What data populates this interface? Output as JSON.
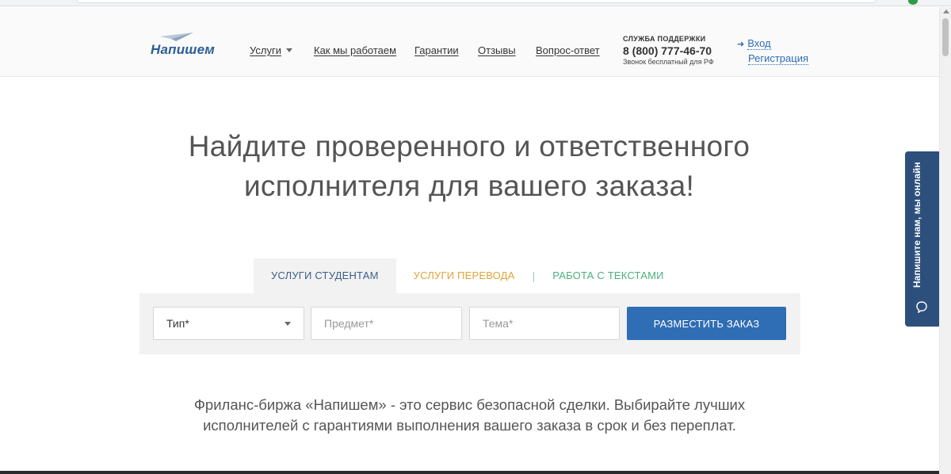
{
  "header": {
    "logo_text": "Напишем",
    "nav": {
      "services": "Услуги",
      "how": "Как мы работаем",
      "guarantees": "Гарантии",
      "reviews": "Отзывы",
      "faq": "Вопрос-ответ"
    },
    "support": {
      "title": "СЛУЖБА ПОДДЕРЖКИ",
      "phone": "8 (800) 777-46-70",
      "note": "Звонок бесплатный для РФ"
    },
    "auth": {
      "login": "Вход",
      "register": "Регистрация"
    }
  },
  "hero": {
    "title_line1": "Найдите проверенного и ответственного",
    "title_line2": "исполнителя для вашего заказа!"
  },
  "tabs": {
    "students": "УСЛУГИ СТУДЕНТАМ",
    "translate": "УСЛУГИ ПЕРЕВОДА",
    "separator": "|",
    "texts": "РАБОТА С ТЕКСТАМИ"
  },
  "form": {
    "type_value": "Тип*",
    "subject_placeholder": "Предмет*",
    "topic_placeholder": "Тема*",
    "submit_label": "РАЗМЕСТИТЬ ЗАКАЗ"
  },
  "description": {
    "line1": "Фриланс-биржа «Напишем» - это сервис безопасной сделки. Выбирайте лучших",
    "line2": "исполнителей с гарантиями выполнения вашего заказа в срок и без переплат."
  },
  "chat": {
    "label": "Напишите нам, мы онлайн"
  },
  "colors": {
    "brand_blue": "#2f6db4",
    "logo_blue": "#2d5e97",
    "chat_bg": "#2d4f7c",
    "translate_orange": "#e0a53a",
    "texts_green": "#4caf7d"
  },
  "icons": {
    "dropdown": "chevron-down-icon",
    "login": "arrow-right-icon",
    "chat": "chat-bubble-icon",
    "logo": "paper-plane-icon"
  }
}
